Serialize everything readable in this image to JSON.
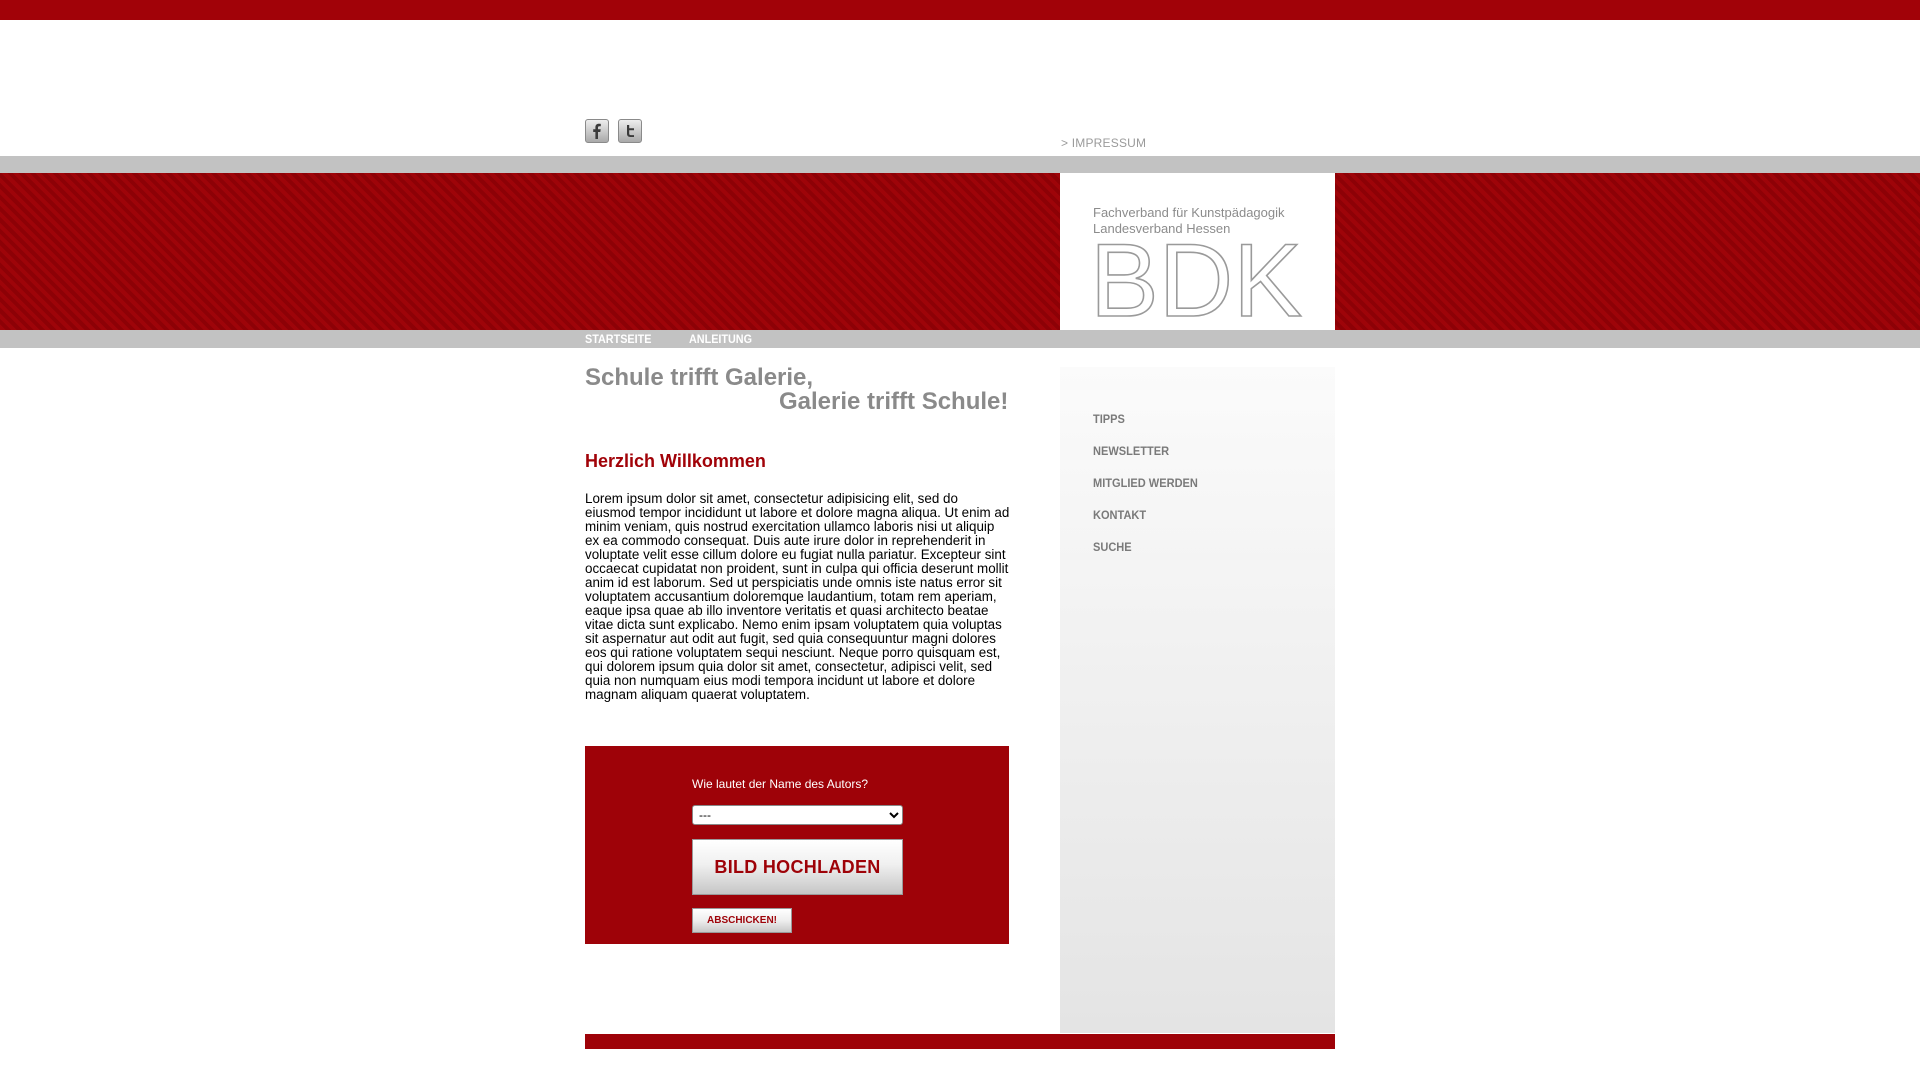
{
  "header": {
    "social": [
      {
        "name": "facebook",
        "icon": "facebook-icon"
      },
      {
        "name": "twitter",
        "icon": "twitter-icon"
      }
    ],
    "impressum_label": "> IMPRESSUM"
  },
  "logo": {
    "line1": "Fachverband für Kunstpädagogik",
    "line2": "Landesverband Hessen",
    "mark": "BDK"
  },
  "nav": {
    "items": [
      "STARTSEITE",
      "ANLEITUNG"
    ]
  },
  "main": {
    "headline_line1": "Schule trifft Galerie,",
    "headline_line2": "Galerie trifft Schule!",
    "welcome": "Herzlich Willkommen",
    "body": "Lorem ipsum dolor sit amet, consectetur adipisicing elit, sed do eiusmod tempor incididunt ut labore et dolore magna aliqua. Ut enim ad minim veniam, quis nostrud exercitation ullamco laboris nisi ut aliquip ex ea commodo consequat. Duis aute irure dolor in reprehenderit in voluptate velit esse cillum dolore eu fugiat nulla pariatur. Excepteur sint occaecat cupidatat non proident, sunt in culpa qui officia deserunt mollit anim id est laborum. Sed ut perspiciatis unde omnis iste natus error sit voluptatem accusantium doloremque laudantium, totam rem aperiam, eaque ipsa quae ab illo inventore veritatis et quasi architecto beatae vitae dicta sunt explicabo. Nemo enim ipsam voluptatem quia voluptas sit aspernatur aut odit aut fugit, sed quia consequuntur magni dolores eos qui ratione voluptatem sequi nesciunt. Neque porro quisquam est, qui dolorem ipsum quia dolor sit amet, consectetur, adipisci velit, sed quia non numquam eius modi tempora incidunt ut labore et dolore magnam aliquam quaerat voluptatem."
  },
  "form": {
    "question": "Wie lautet der Name des Autors?",
    "select_value": "---",
    "upload_label": "BILD HOCHLADEN",
    "submit_label": "ABSCHICKEN!"
  },
  "sidebar": {
    "items": [
      "TIPPS",
      "NEWSLETTER",
      "MITGLIED WERDEN",
      "KONTAKT",
      "SUCHE"
    ]
  },
  "colors": {
    "brand_red": "#a10208",
    "bar_grey": "#c2c2c2",
    "text_grey": "#8a8a8a"
  }
}
